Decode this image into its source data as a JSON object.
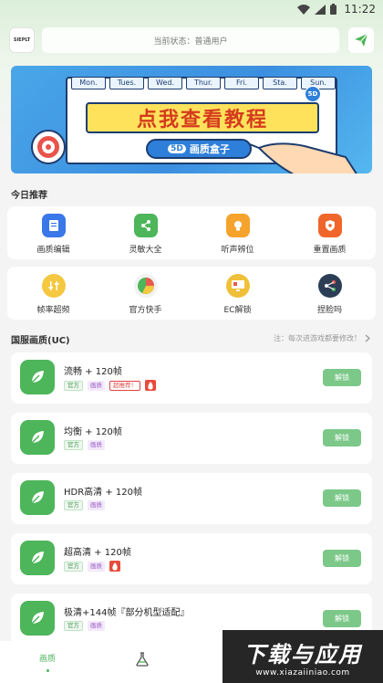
{
  "status_bar": {
    "time": "11:22"
  },
  "top_bar": {
    "logo_text": "SIEPLT",
    "status_text": "当前状态：普通用户"
  },
  "banner": {
    "days": [
      "Mon.",
      "Tues.",
      "Wed.",
      "Thur.",
      "Fri.",
      "Sta.",
      "Sun."
    ],
    "title": "点我查看教程",
    "subtitle": "画质盒子",
    "badge": "5D"
  },
  "today_section": {
    "title": "今日推荐",
    "row1": [
      {
        "label": "画质编辑",
        "icon": "edit-doc-icon",
        "color": "#3a77e8"
      },
      {
        "label": "灵敏大全",
        "icon": "share-icon",
        "color": "#4db55a"
      },
      {
        "label": "听声辨位",
        "icon": "lightbulb-icon",
        "color": "#f5a32d"
      },
      {
        "label": "重置画质",
        "icon": "shield-icon",
        "color": "#f0662a"
      }
    ],
    "row2": [
      {
        "label": "帧率超频",
        "icon": "sliders-icon",
        "color": "#f5c842"
      },
      {
        "label": "官方快手",
        "icon": "pie-chart-icon",
        "color": "#e85a4f"
      },
      {
        "label": "EC解锁",
        "icon": "monitor-icon",
        "color": "#f0c03a"
      },
      {
        "label": "捏脸吗",
        "icon": "connect-icon",
        "color": "#2c3e55"
      }
    ]
  },
  "presets_section": {
    "title": "国服画质(UC)",
    "note": "注：每次进游戏都要修改！",
    "tag_official": "官方",
    "tag_quality": "画质",
    "tag_recommend": "超推荐！",
    "unlock_label": "解锁",
    "items": [
      {
        "title": "流畅 + 120帧",
        "recommended": true,
        "hot": true
      },
      {
        "title": "均衡 + 120帧",
        "recommended": false,
        "hot": false
      },
      {
        "title": "HDR高清 + 120帧",
        "recommended": false,
        "hot": false
      },
      {
        "title": "超高清 + 120帧",
        "recommended": false,
        "hot": true
      },
      {
        "title": "极清+144帧『部分机型适配』",
        "recommended": false,
        "hot": false
      }
    ]
  },
  "bottom_nav": {
    "tab1_label": "画质"
  },
  "watermark": {
    "main": "下载与应用",
    "sub": "www.xiazaiiniao.com"
  }
}
